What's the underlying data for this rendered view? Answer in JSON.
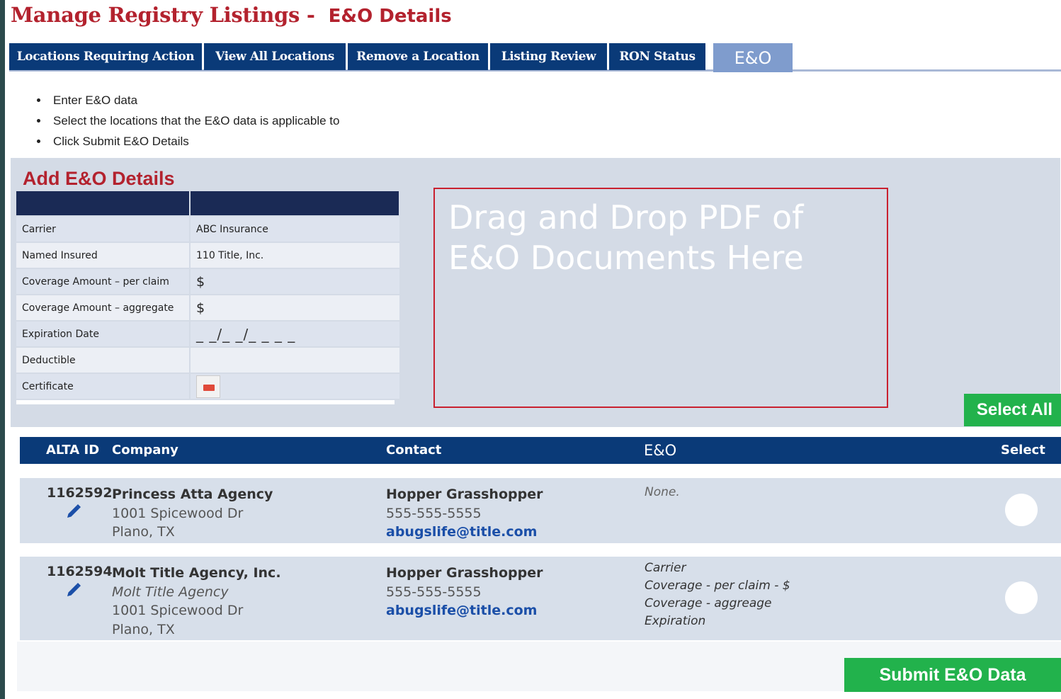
{
  "header": {
    "title": "Manage Registry Listings -",
    "subtitle": "E&O Details"
  },
  "tabs": [
    {
      "label": "Locations Requiring Action"
    },
    {
      "label": "View All Locations"
    },
    {
      "label": "Remove a Location"
    },
    {
      "label": "Listing Review"
    },
    {
      "label": "RON Status"
    },
    {
      "label": "E&O",
      "active": true
    }
  ],
  "instructions": [
    "Enter E&O data",
    "Select the locations that the E&O data is applicable to",
    "Click Submit E&O Details"
  ],
  "add_form": {
    "title": "Add E&O Details",
    "rows": [
      {
        "label": "Carrier",
        "value": "ABC Insurance"
      },
      {
        "label": "Named Insured",
        "value": "110 Title, Inc."
      },
      {
        "label": "Coverage Amount – per claim",
        "value": "$"
      },
      {
        "label": "Coverage Amount – aggregate",
        "value": "$"
      },
      {
        "label": "Expiration Date",
        "value": "_ _/_ _/_ _ _ _"
      },
      {
        "label": "Deductible",
        "value": ""
      },
      {
        "label": "Certificate",
        "value": ""
      }
    ],
    "certificate_icon": "pdf-file-icon"
  },
  "dropzone": {
    "text": "Drag and Drop PDF of E&O Documents Here"
  },
  "select_all_label": "Select All",
  "locations_table": {
    "headers": {
      "alta_id": "ALTA ID",
      "company": "Company",
      "contact": "Contact",
      "eo": "E&O",
      "select": "Select"
    },
    "rows": [
      {
        "alta_id": "1162592",
        "company_name": "Princess Atta Agency",
        "company_alias": "",
        "address1": "1001 Spicewood Dr",
        "address2": "Plano, TX",
        "contact_name": "Hopper Grasshopper",
        "contact_phone": "555-555-5555",
        "contact_email": "abugslife@title.com",
        "eo_lines": [
          "None."
        ]
      },
      {
        "alta_id": "1162594",
        "company_name": "Molt Title Agency, Inc.",
        "company_alias": "Molt Title Agency",
        "address1": "1001 Spicewood Dr",
        "address2": "Plano, TX",
        "contact_name": "Hopper Grasshopper",
        "contact_phone": "555-555-5555",
        "contact_email": "abugslife@title.com",
        "eo_lines": [
          "Carrier",
          "Coverage - per claim - $",
          "Coverage - aggreage",
          "Expiration"
        ]
      }
    ]
  },
  "submit_label": "Submit E&O Data",
  "colors": {
    "brand_red": "#b3222e",
    "nav_blue": "#0a3a78",
    "active_tab": "#7f9ccd",
    "green": "#22b24c",
    "panel": "#d4dbe6"
  }
}
